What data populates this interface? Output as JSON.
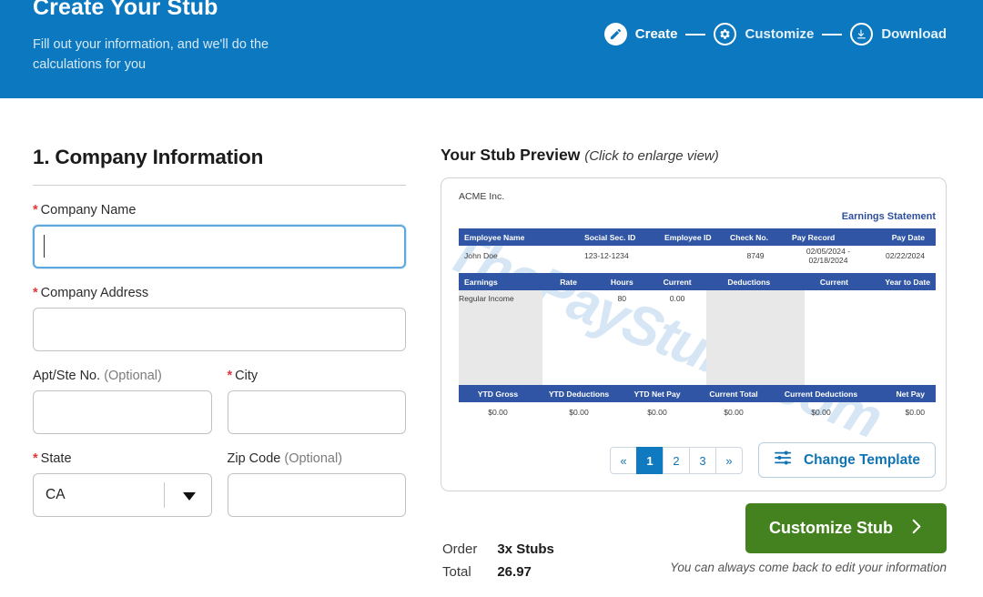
{
  "header": {
    "title": "Create Your Stub",
    "subtitle": "Fill out your information, and we'll do the calculations for you",
    "brand_blue": "#0b78bf",
    "steps": [
      {
        "label": "Create",
        "icon": "pencil-icon",
        "state": "active"
      },
      {
        "label": "Customize",
        "icon": "gear-icon",
        "state": "upcoming"
      },
      {
        "label": "Download",
        "icon": "download-icon",
        "state": "upcoming"
      }
    ]
  },
  "form": {
    "section_title": "1. Company Information",
    "required_marker": "*",
    "optional_marker": "(Optional)",
    "fields": {
      "company_name": {
        "label": "Company Name",
        "value": "",
        "placeholder": "",
        "required": true,
        "focused": true
      },
      "company_address": {
        "label": "Company Address",
        "value": "",
        "placeholder": "",
        "required": true
      },
      "apt": {
        "label": "Apt/Ste No.",
        "value": "",
        "placeholder": "",
        "required": false,
        "optional_tag": "(Optional)"
      },
      "city": {
        "label": "City",
        "value": "",
        "placeholder": "",
        "required": true
      },
      "state": {
        "label": "State",
        "value": "CA",
        "required": true,
        "options": [
          "CA"
        ]
      },
      "zip": {
        "label": "Zip Code",
        "value": "",
        "placeholder": "",
        "required": false,
        "optional_tag": "(Optional)"
      }
    }
  },
  "preview": {
    "heading": "Your Stub Preview",
    "heading_note": "(Click to enlarge view)",
    "watermark": "ThePayStubs.com",
    "stub": {
      "company": "ACME Inc.",
      "statement_label": "Earnings Statement",
      "statement_color": "#2e4fa0",
      "table_header_color": "#2f55a4",
      "employee_headers": [
        "Employee Name",
        "Social Sec. ID",
        "Employee ID",
        "Check No.",
        "Pay Record",
        "Pay Date"
      ],
      "employee_row": [
        "John Doe",
        "123-12-1234",
        "",
        "8749",
        "02/05/2024 - 02/18/2024",
        "02/22/2024"
      ],
      "earnings_headers": [
        "Earnings",
        "Rate",
        "Hours",
        "Current",
        "Deductions",
        "Current",
        "Year to Date"
      ],
      "earnings_rows": [
        {
          "earnings": "Regular Income",
          "rate": "",
          "hours": "80",
          "current": "0.00",
          "deductions": "",
          "ded_current": "",
          "ytd": ""
        }
      ],
      "ytd_headers": [
        "YTD Gross",
        "YTD Deductions",
        "YTD Net Pay",
        "Current Total",
        "Current Deductions",
        "Net Pay"
      ],
      "ytd_row": [
        "$0.00",
        "$0.00",
        "$0.00",
        "$0.00",
        "$0.00",
        "$0.00"
      ]
    },
    "pagination": {
      "prev": "«",
      "next": "»",
      "pages": [
        "1",
        "2",
        "3"
      ],
      "active": "1"
    },
    "change_template_label": "Change Template",
    "change_template_icon": "sliders-icon"
  },
  "footer": {
    "order_label": "Order",
    "order_value": "3x Stubs",
    "total_label": "Total",
    "total_value": "26.97",
    "cta_label": "Customize Stub",
    "cta_icon": "chevron-right-icon",
    "cta_color": "#44821f",
    "note": "You can always come back to edit your information"
  }
}
